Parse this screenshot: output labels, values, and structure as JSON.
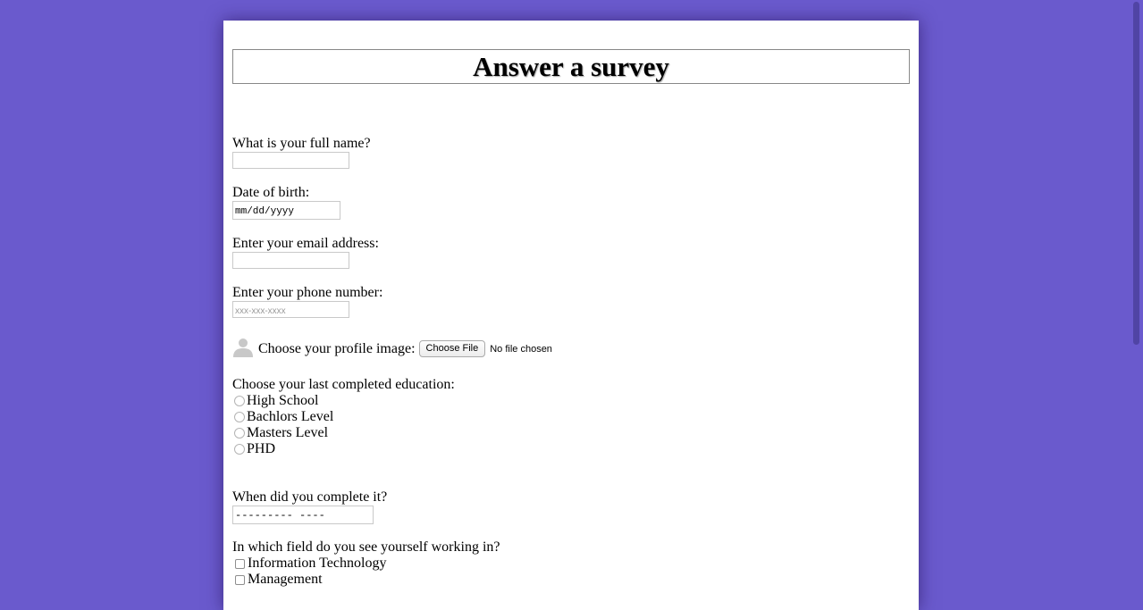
{
  "survey": {
    "title": "Answer a survey",
    "name_label": "What is your full name?",
    "name_value": "",
    "dob_label": "Date of birth:",
    "dob_placeholder": "mm/dd/yyyy",
    "email_label": "Enter your email address:",
    "email_value": "",
    "phone_label": "Enter your phone number:",
    "phone_placeholder": "xxx-xxx-xxxx",
    "profile_label": "Choose your profile image:",
    "file_button": "Choose File",
    "file_status": "No file chosen",
    "education_label": "Choose your last completed education:",
    "education_options": [
      "High School",
      "Bachlors Level",
      "Masters Level",
      "PHD"
    ],
    "completed_label": "When did you complete it?",
    "completed_placeholder": "--------- ----",
    "field_label": "In which field do you see yourself working in?",
    "field_options": [
      "Information Technology",
      "Management"
    ]
  },
  "icons": {
    "profile": "person-silhouette-icon"
  },
  "colors": {
    "background": "#6a5acd",
    "panel": "#ffffff"
  }
}
